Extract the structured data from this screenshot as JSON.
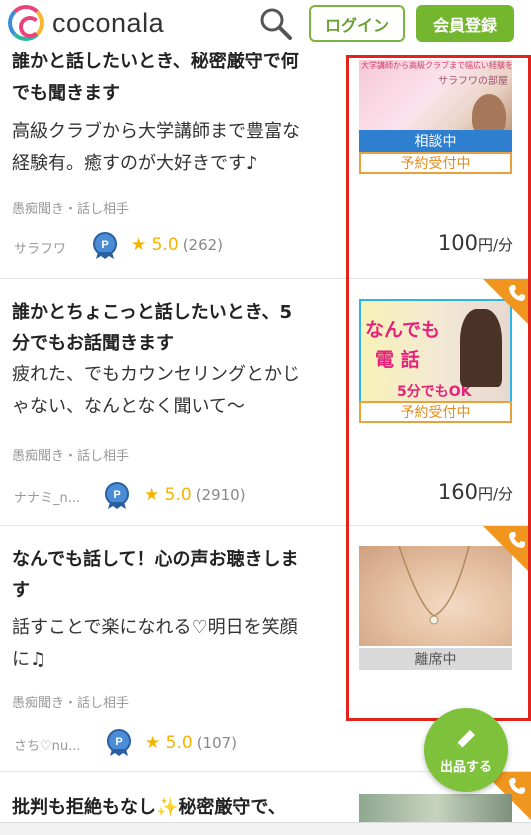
{
  "header": {
    "logo_text": "coconala",
    "login_label": "ログイン",
    "register_label": "会員登録"
  },
  "colors": {
    "brand_green": "#74b72e",
    "phone_orange": "#f0961f",
    "consult_blue": "#2f7fd1",
    "highlight_red": "#e32219",
    "star_yellow": "#f5b400"
  },
  "listings": [
    {
      "title": "誰かと話したいとき、秘密厳守で何でも聞きます",
      "title_visible_line1": "誰かと話したいとき、秘密厳守で何",
      "title_visible_line2": "でも聞きます",
      "desc_line1": "高級クラブから大学講師まで豊富な",
      "desc_line2": "経験有。癒すのが大好きです♪",
      "category": "愚痴聞き・話し相手",
      "user": "サラフワ",
      "rating": "5.0",
      "review_count": "(262)",
      "price": "100",
      "price_unit": "円/分",
      "statuses": [
        "相談中",
        "予約受付中"
      ],
      "thumb_caption": "大学講師から高級クラブまで幅広い経験を",
      "thumb_name": "サラフワの部屋",
      "has_phone": false
    },
    {
      "title_line1": "誰かとちょこっと話したいとき、5",
      "title_line2": "分でもお話聞きます",
      "desc_line1": "疲れた、でもカウンセリングとかじ",
      "desc_line2": "ゃない、なんとなく聞いて〜",
      "category": "愚痴聞き・話し相手",
      "user": "ナナミ_n...",
      "rating": "5.0",
      "review_count": "(2910)",
      "price": "160",
      "price_unit": "円/分",
      "statuses": [
        "予約受付中"
      ],
      "thumb_text1": "なんでも",
      "thumb_text2": "電 話",
      "thumb_text3": "5分でもOK",
      "has_phone": true
    },
    {
      "title_line1": "なんでも話して！心の声お聴きしま",
      "title_line2": "す",
      "desc_line1": "話すことで楽になれる♡明日を笑顔",
      "desc_line2": "に♫",
      "category": "愚痴聞き・話し相手",
      "user": "さち♡nu...",
      "rating": "5.0",
      "review_count": "(107)",
      "statuses": [
        "離席中"
      ],
      "has_phone": true
    },
    {
      "title_line1": "批判も拒絶もなし✨秘密厳守で、",
      "has_phone": true
    }
  ],
  "fab": {
    "label": "出品する"
  }
}
